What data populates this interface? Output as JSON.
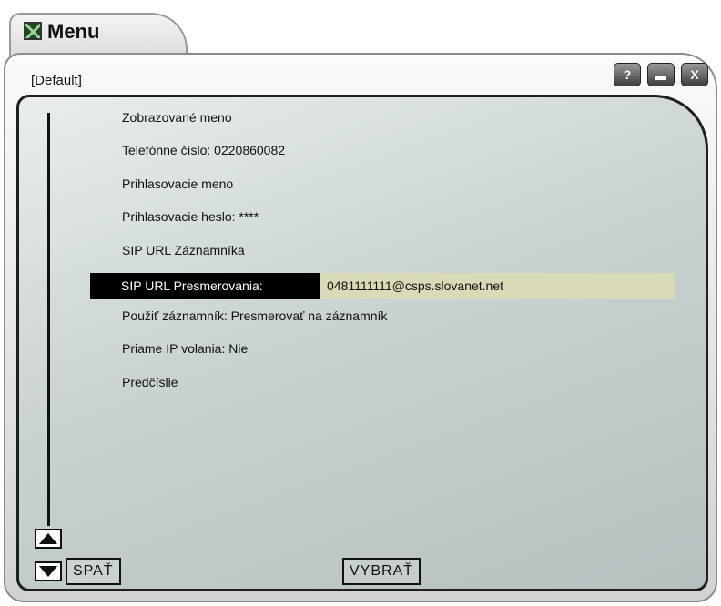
{
  "window": {
    "title": "Menu",
    "profile": "[Default]",
    "help_label": "?",
    "close_label": "X"
  },
  "menu": {
    "items": [
      {
        "text": "Zobrazované meno"
      },
      {
        "text": "Telefónne číslo: 0220860082"
      },
      {
        "text": "Prihlasovacie meno"
      },
      {
        "text": "Prihlasovacie heslo: ****"
      },
      {
        "text": "SIP URL Záznamníka"
      },
      {
        "text": "Použiť záznamník: Presmerovať na záznamník"
      },
      {
        "text": "Priame IP volania: Nie"
      },
      {
        "text": "Predčíslie"
      }
    ],
    "selected": {
      "label": "SIP URL Presmerovania:",
      "value": "0481111111@csps.slovanet.net"
    }
  },
  "softkeys": {
    "back": "SPAŤ",
    "select": "VYBRAŤ"
  },
  "icons": {
    "app": "app-logo-icon",
    "scroll_up": "arrow-up-icon",
    "scroll_down": "arrow-down-icon",
    "help": "help-icon",
    "minimize": "minimize-icon",
    "close": "close-icon"
  },
  "colors": {
    "selected_label_bg": "#000000",
    "selected_value_bg": "#d9dbb7",
    "panel_bg": "#c9d3d1"
  }
}
